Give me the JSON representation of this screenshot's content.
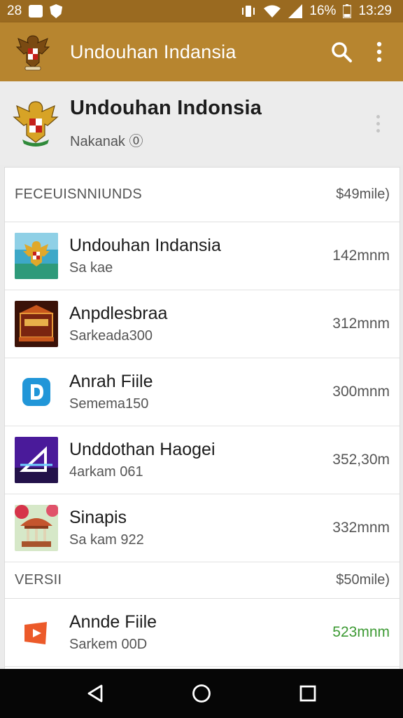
{
  "status_bar": {
    "left_text": "28",
    "battery": "16%",
    "time": "13:29",
    "icons": [
      "image-icon",
      "shield-icon",
      "vibrate-icon",
      "wifi-icon",
      "signal-icon",
      "battery-icon"
    ]
  },
  "app_bar": {
    "title": "Undouhan Indansia",
    "actions": [
      "search-icon",
      "more-vert-icon"
    ]
  },
  "header": {
    "title": "Undouhan Indonsia",
    "subtitle": "Nakanak ⓪"
  },
  "sections": [
    {
      "label": "FECEUISNNIUNDS",
      "value": "$49mile)",
      "items": [
        {
          "title": "Undouhan Indansia",
          "subtitle": "Sa kae",
          "size": "142mnm",
          "icon": "landscape-emblem-icon"
        },
        {
          "title": "Anpdlesbraa",
          "subtitle": "Sarkeada300",
          "size": "312mnm",
          "icon": "temple-sign-icon"
        },
        {
          "title": "Anrah Fiile",
          "subtitle": "Semema150",
          "size": "300mnm",
          "icon": "letter-d-icon"
        },
        {
          "title": "Unddothan Haogei",
          "subtitle": "4arkam 061",
          "size": "352,30m",
          "icon": "purple-triangle-icon"
        },
        {
          "title": "Sinapis",
          "subtitle": "Sa kam 922",
          "size": "332mnm",
          "icon": "gazebo-icon"
        }
      ]
    },
    {
      "label": "VERSII",
      "value": "$50mile)",
      "items": [
        {
          "title": "Annde Fiile",
          "subtitle": "Sarkem 00D",
          "size": "523mnm",
          "icon": "orange-play-icon",
          "size_color": "#3d9a34"
        }
      ]
    }
  ],
  "colors": {
    "status_bar": "#9a6a20",
    "app_bar": "#b7852f",
    "nav_bar": "#060606",
    "size_green": "#3d9a34"
  },
  "nav": [
    "back-icon",
    "home-icon",
    "recents-icon"
  ]
}
